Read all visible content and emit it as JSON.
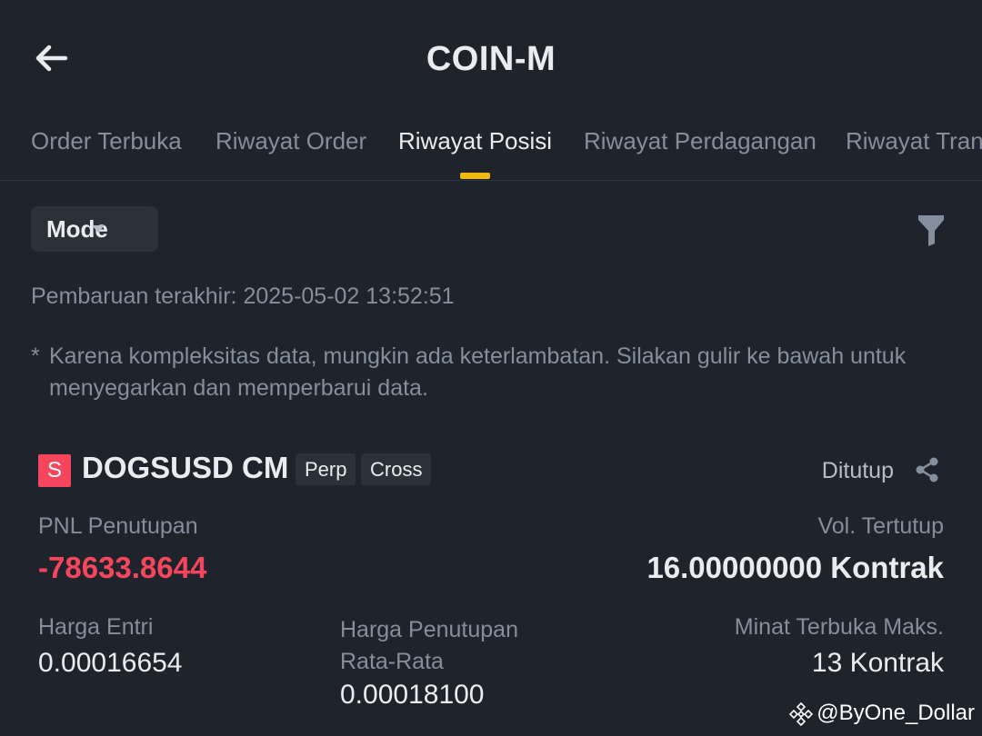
{
  "header": {
    "title": "COIN-M",
    "back_icon": "arrow-left-icon"
  },
  "tabs": [
    {
      "label": "Order Terbuka",
      "active": false
    },
    {
      "label": "Riwayat Order",
      "active": false
    },
    {
      "label": "Riwayat Posisi",
      "active": true
    },
    {
      "label": "Riwayat Perdagangan",
      "active": false
    },
    {
      "label": "Riwayat Tran",
      "active": false
    }
  ],
  "colors": {
    "background": "#1f232b",
    "accent": "#f0b90b",
    "negative": "#f6465d",
    "muted": "#848e9c"
  },
  "toolbar": {
    "mode_label": "Mode",
    "filter_icon": "filter-icon"
  },
  "info": {
    "last_update": "Pembaruan terakhir: 2025-05-02 13:52:51",
    "note_star": "*",
    "note": "Karena kompleksitas data, mungkin ada keterlambatan. Silakan gulir ke bawah untuk menyegarkan dan memperbarui data."
  },
  "position": {
    "side": "S",
    "symbol": "DOGSUSD CM",
    "tags": [
      "Perp",
      "Cross"
    ],
    "status": "Ditutup",
    "share_icon": "share-icon",
    "pnl_label": "PNL Penutupan",
    "pnl_value": "-78633.8644",
    "vol_label": "Vol. Tertutup",
    "vol_value": "16.00000000 Kontrak",
    "entry_label": "Harga Entri",
    "entry_value": "0.00016654",
    "avg_close_label": "Harga Penutupan Rata-Rata",
    "avg_close_value": "0.00018100",
    "max_oi_label": "Minat Terbuka Maks.",
    "max_oi_value": "13 Kontrak"
  },
  "watermark": "@ByOne_Dollar"
}
